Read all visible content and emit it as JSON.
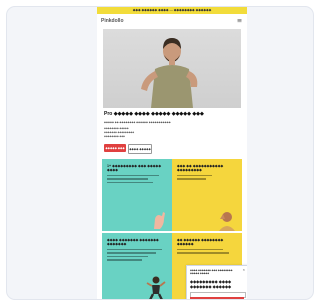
{
  "banner": {
    "text": "◆◆◆ ◆◆◆◆◆◆ ◆◆◆◆ — ◆◆◆◆◆◆◆◆ ◆◆◆◆◆◆"
  },
  "header": {
    "logo": "Pinkdollo"
  },
  "hero": {
    "title": "Pro ◆◆◆◆◆ ◆◆◆◆ ◆◆◆◆◆ ◆◆◆◆◆ ◆◆◆"
  },
  "content": {
    "subtitle": "◆◆◆◆◆ ◆◆ ◆◆◆◆◆◆◆◆ ◆◆◆◆◆◆ ◆◆◆◆◆◆◆◆◆◆◆",
    "bullets": [
      "◆◆◆◆◆◆◆◆ ◆◆◆◆◆",
      "◆◆◆◆◆◆◆ ◆◆◆◆◆◆◆◆◆",
      "◆◆◆◆◆◆◆◆ ◆◆◆"
    ],
    "primary_button": "◆◆◆◆◆ ◆◆◆",
    "secondary_button": "◆◆◆◆ ◆◆◆◆◆"
  },
  "tiles": [
    {
      "title": "1+ ◆◆◆◆◆◆◆◆◆ ◆◆◆ ◆◆◆◆◆ ◆◆◆◆",
      "color": "#69d2c3"
    },
    {
      "title": "◆◆◆ ◆◆ ◆◆◆◆◆◆◆◆◆◆◆ ◆◆◆◆◆◆◆◆◆",
      "color": "#f5d63d"
    },
    {
      "title": "◆◆◆◆ ◆◆◆◆◆◆◆ ◆◆◆◆◆◆◆ ◆◆◆◆◆◆◆",
      "color": "#69d2c3"
    },
    {
      "title": "◆◆ ◆◆◆◆◆◆ ◆◆◆◆◆◆◆◆ ◆◆◆◆◆◆",
      "color": "#f5d63d"
    }
  ],
  "popup": {
    "text": "◆◆◆◆ ◆◆◆◆◆◆◆ ◆◆◆ ◆◆◆◆◆◆◆◆ ◆◆◆◆◆ ◆◆◆◆◆",
    "headline": "◆◆◆◆◆◆◆◆◆ ◆◆◆◆ ◆◆◆◆◆◆◆ ◆◆◆◆◆◆",
    "close": "×"
  },
  "colors": {
    "accent": "#e0403f",
    "banner": "#f2dc3a",
    "teal": "#69d2c3",
    "yellow": "#f5d63d"
  }
}
